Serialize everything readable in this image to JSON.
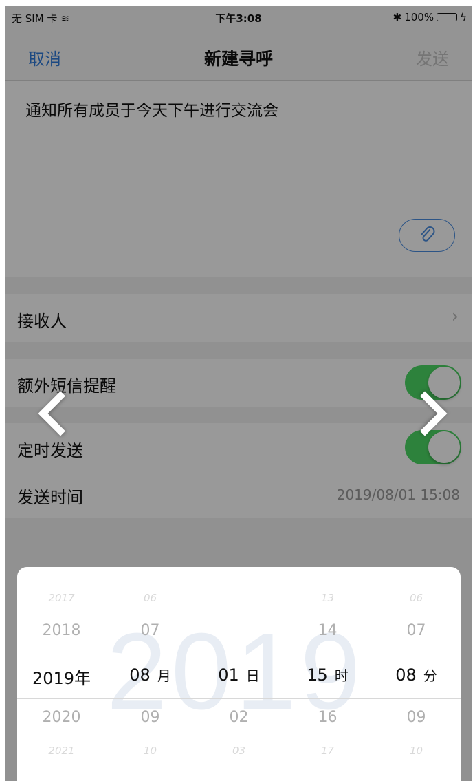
{
  "status_bar": {
    "carrier": "无 SIM 卡",
    "time": "下午3:08",
    "battery": "100%"
  },
  "nav": {
    "cancel": "取消",
    "title": "新建寻呼",
    "send": "发送"
  },
  "message": {
    "text": "通知所有成员于今天下午进行交流会"
  },
  "rows": {
    "recipient": "接收人",
    "sms_reminder": "额外短信提醒",
    "scheduled_send": "定时发送",
    "send_time_label": "发送时间",
    "send_time_value": "2019/08/01 15:08"
  },
  "toggles": {
    "sms_reminder": true,
    "scheduled_send": true
  },
  "picker": {
    "watermark": "2019",
    "year": {
      "far_prev": "2017",
      "prev": "2018",
      "selected": "2019",
      "unit": "年",
      "next": "2020",
      "far_next": "2021"
    },
    "month": {
      "far_prev": "06",
      "prev": "07",
      "selected": "08",
      "unit": "月",
      "next": "09",
      "far_next": "10"
    },
    "day": {
      "far_prev": "",
      "prev": "",
      "selected": "01",
      "unit": "日",
      "next": "02",
      "far_next": "03"
    },
    "hour": {
      "far_prev": "13",
      "prev": "14",
      "selected": "15",
      "unit": "时",
      "next": "16",
      "far_next": "17"
    },
    "minute": {
      "far_prev": "06",
      "prev": "07",
      "selected": "08",
      "unit": "分",
      "next": "09",
      "far_next": "10"
    }
  },
  "colors": {
    "accent": "#2f7ad9",
    "toggle_on": "#4cd964"
  }
}
